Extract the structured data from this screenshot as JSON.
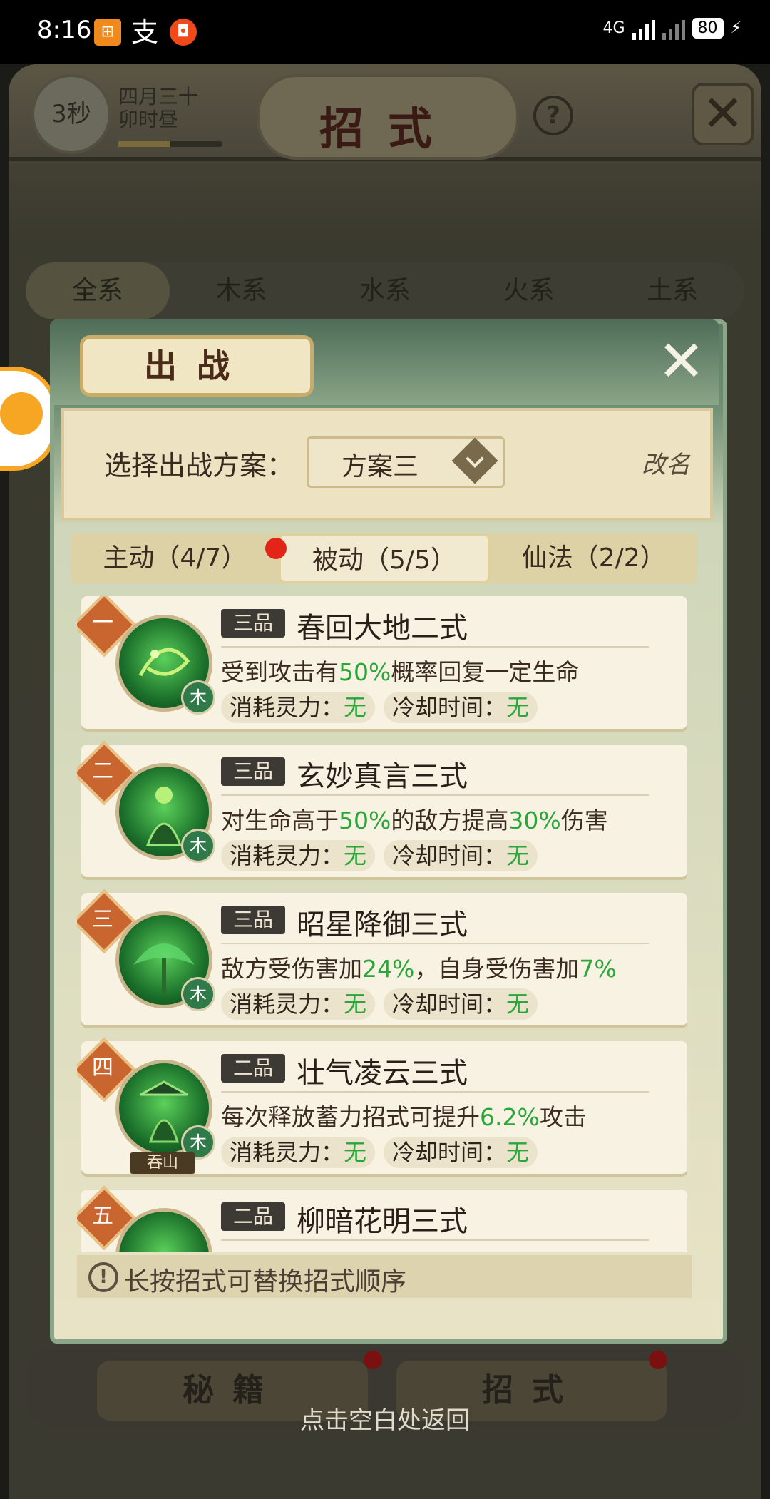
{
  "status_bar": {
    "time": "8:16",
    "network": "4G",
    "battery": "80"
  },
  "background": {
    "timer": "3秒",
    "date_line1": "四月三十",
    "date_line2": "卯时昼",
    "title": "招式",
    "help": "?",
    "element_tabs": [
      "全系",
      "木系",
      "水系",
      "火系",
      "土系"
    ],
    "bottom_buttons": [
      "秘籍",
      "招式"
    ],
    "return_hint": "点击空白处返回"
  },
  "modal": {
    "title": "出战",
    "scheme_label": "选择出战方案：",
    "scheme_value": "方案三",
    "rename_label": "改名",
    "tabs": [
      {
        "label": "主动（4/7）"
      },
      {
        "label": "被动（5/5）"
      },
      {
        "label": "仙法（2/2）"
      }
    ],
    "active_tab_index": 1,
    "cost_label": "消耗灵力：",
    "cooldown_label": "冷却时间：",
    "hint": "长按招式可替换招式顺序",
    "skills": [
      {
        "rank": "一",
        "grade": "三品",
        "name": "春回大地二式",
        "desc_parts": [
          "受到攻击有",
          "50%",
          "概率回复一定生命",
          "",
          ""
        ],
        "element": "木",
        "cost": "无",
        "cooldown": "无"
      },
      {
        "rank": "二",
        "grade": "三品",
        "name": "玄妙真言三式",
        "desc_parts": [
          "对生命高于",
          "50%",
          "的敌方提高",
          "30%",
          "伤害"
        ],
        "element": "木",
        "cost": "无",
        "cooldown": "无"
      },
      {
        "rank": "三",
        "grade": "三品",
        "name": "昭星降御三式",
        "desc_parts": [
          "敌方受伤害加",
          "24%",
          "，自身受伤害加",
          "7%",
          ""
        ],
        "element": "木",
        "cost": "无",
        "cooldown": "无"
      },
      {
        "rank": "四",
        "grade": "二品",
        "name": "壮气凌云三式",
        "desc_parts": [
          "每次释放蓄力招式可提升",
          "6.2%",
          "攻击",
          "",
          ""
        ],
        "element": "木",
        "tag": "吞山",
        "cost": "无",
        "cooldown": "无"
      },
      {
        "rank": "五",
        "grade": "二品",
        "name": "柳暗花明三式"
      }
    ]
  }
}
